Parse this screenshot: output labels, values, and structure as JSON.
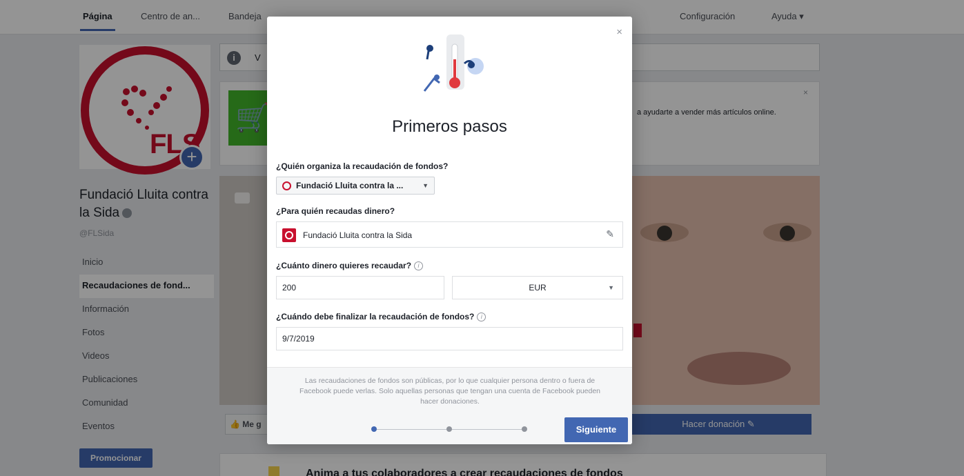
{
  "topnav": {
    "tabs": [
      "Página",
      "Centro de an...",
      "Bandeja"
    ],
    "settings": "Configuración",
    "help": "Ayuda ▾"
  },
  "profile": {
    "logo_text": "FLS",
    "name": "Fundació Lluita contra la Sida",
    "handle": "@FLSida",
    "nav": [
      "Inicio",
      "Recaudaciones de fond...",
      "Información",
      "Fotos",
      "Videos",
      "Publicaciones",
      "Comunidad",
      "Eventos"
    ],
    "promote": "Promocionar"
  },
  "background": {
    "info_text": "V",
    "shop_text": "a ayudarte a vender más artículos online.",
    "like_button": "Me g",
    "donate_button": "Hacer donación ✎",
    "bottom_card_text": "Anima a tus colaboradores a crear recaudaciones de fondos"
  },
  "modal": {
    "title": "Primeros pasos",
    "close": "×",
    "organizer_label": "¿Quién organiza la recaudación de fondos?",
    "organizer_value": "Fundació Lluita contra la ...",
    "beneficiary_label": "¿Para quién recaudas dinero?",
    "beneficiary_value": "Fundació Lluita contra la Sida",
    "amount_label": "¿Cuánto dinero quieres recaudar?",
    "amount_value": "200",
    "currency": "EUR",
    "enddate_label": "¿Cuándo debe finalizar la recaudación de fondos?",
    "enddate_value": "9/7/2019",
    "notice": "Las recaudaciones de fondos son públicas, por lo que cualquier persona dentro o fuera de Facebook puede verlas. Solo aquellas personas que tengan una cuenta de Facebook pueden hacer donaciones.",
    "step_current": 1,
    "step_total": 3,
    "next_button": "Siguiente"
  },
  "colors": {
    "brand_blue": "#4267b2",
    "fls_red": "#c8102e"
  }
}
